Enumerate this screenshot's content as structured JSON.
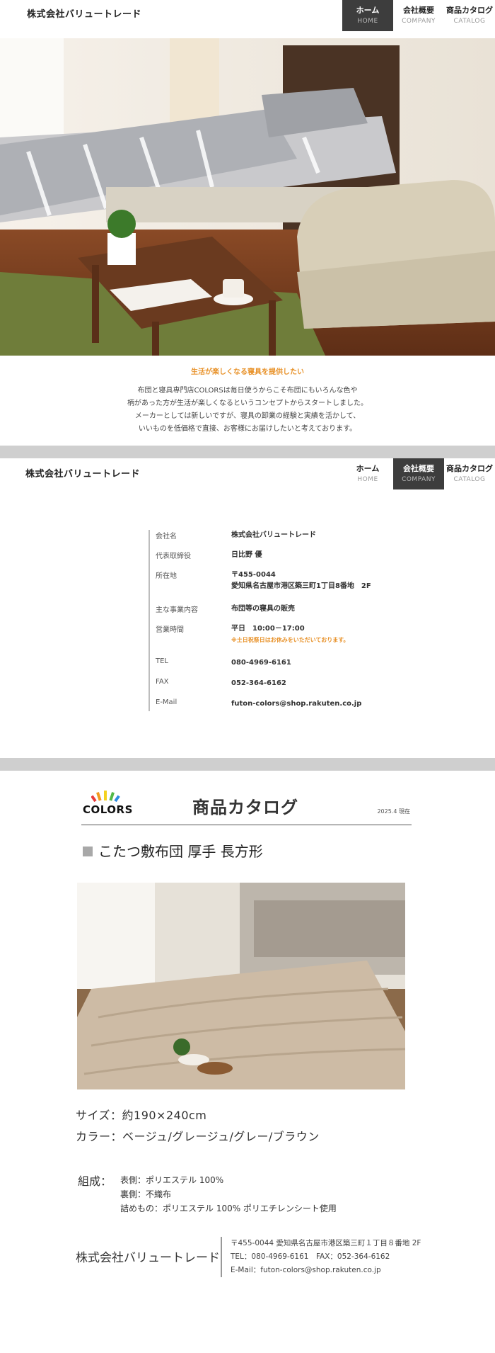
{
  "header": {
    "brand": "株式会社バリュートレード",
    "nav": [
      {
        "jp": "ホーム",
        "en": "HOME"
      },
      {
        "jp": "会社概要",
        "en": "COMPANY"
      },
      {
        "jp": "商品カタログ",
        "en": "CATALOG"
      }
    ]
  },
  "hero": {
    "tagline": "生活が楽しくなる寝具を提供したい",
    "intro_lines": [
      "布団と寝具専門店COLORSは毎日使うからこそ布団にもいろんな色や",
      "柄があった方が生活が楽しくなるというコンセプトからスタートしました。",
      "メーカーとしては新しいですが、寝具の卸業の経験と実績を活かして、",
      "いいものを低価格で直接、お客様にお届けしたいと考えております。"
    ]
  },
  "company": {
    "rows": [
      {
        "key": "会社名",
        "value": "株式会社バリュートレード"
      },
      {
        "key": "代表取締役",
        "value": "日比野 優"
      },
      {
        "key": "所在地",
        "value": "〒455-0044",
        "value2": "愛知県名古屋市港区築三町1丁目8番地　2F"
      },
      {
        "key": "主な事業内容",
        "value": "布団等の寝具の販売"
      },
      {
        "key": "営業時間",
        "value": "平日　10:00－17:00",
        "note": "※土日祝祭日はお休みをいただいております。"
      },
      {
        "key": "TEL",
        "value": "080-4969-6161"
      },
      {
        "key": "FAX",
        "value": "052-364-6162"
      },
      {
        "key": "E-Mail",
        "value": "futon-colors@shop.rakuten.co.jp"
      }
    ]
  },
  "catalog": {
    "logo": "COLORS",
    "title": "商品カタログ",
    "date": "2025.4 現在",
    "product_name": "こたつ敷布団 厚手 長方形",
    "size": "サイズ：約190×240cm",
    "color": "カラー：ベージュ/グレージュ/グレー/ブラウン",
    "composition_label": "組成：",
    "composition": [
      "表側：ポリエステル 100%",
      "裏側：不織布",
      "詰めもの：ポリエステル 100% ポリエチレンシート使用"
    ],
    "footer_brand": "株式会社バリュートレード",
    "footer_lines": [
      "〒455-0044 愛知県名古屋市港区築三町１丁目８番地 2F",
      "TEL：080-4969-6161　FAX：052-364-6162",
      "E-Mail：futon-colors@shop.rakuten.co.jp"
    ]
  },
  "colors": {
    "accent": "#e8922a",
    "nav_active": "#3d3d3d",
    "band": "#cfcfcf"
  }
}
